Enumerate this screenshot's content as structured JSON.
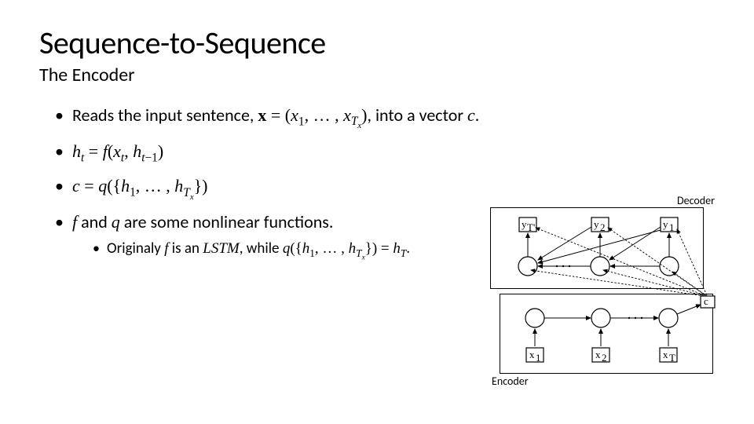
{
  "title": "Sequence-to-Sequence",
  "subtitle": "The Encoder",
  "bullets": {
    "b1_pre": "Reads the input sentence, ",
    "b1_math": "𝒙 = (𝑥₁, … , 𝑥_{T_x})",
    "b1_post": ", into a vector ",
    "b1_c": "𝑐",
    "b1_end": ".",
    "b2": "ℎₜ = 𝑓(𝑥ₜ, ℎₜ₋₁)",
    "b3": "𝑐 = 𝑞({ℎ₁, … , ℎ_{T_x}})",
    "b4_pre": "𝑓",
    "b4_mid": " and ",
    "b4_q": "𝑞",
    "b4_post": " are some nonlinear functions.",
    "b4a_pre": "Originaly ",
    "b4a_f": "𝑓",
    "b4a_mid": " is an ",
    "b4a_lstm": "𝐿𝑆𝑇𝑀",
    "b4a_mid2": ", while ",
    "b4a_q": "𝑞({ℎ₁, … , ℎ_{T_x}}) = ℎ_T",
    "b4a_end": "."
  },
  "diagram": {
    "decoder_label": "Decoder",
    "encoder_label": "Encoder",
    "y_labels": [
      "y_{T'}",
      "y₂",
      "y₁"
    ],
    "x_labels": [
      "x₁",
      "x₂",
      "x_T"
    ],
    "c_label": "c"
  }
}
